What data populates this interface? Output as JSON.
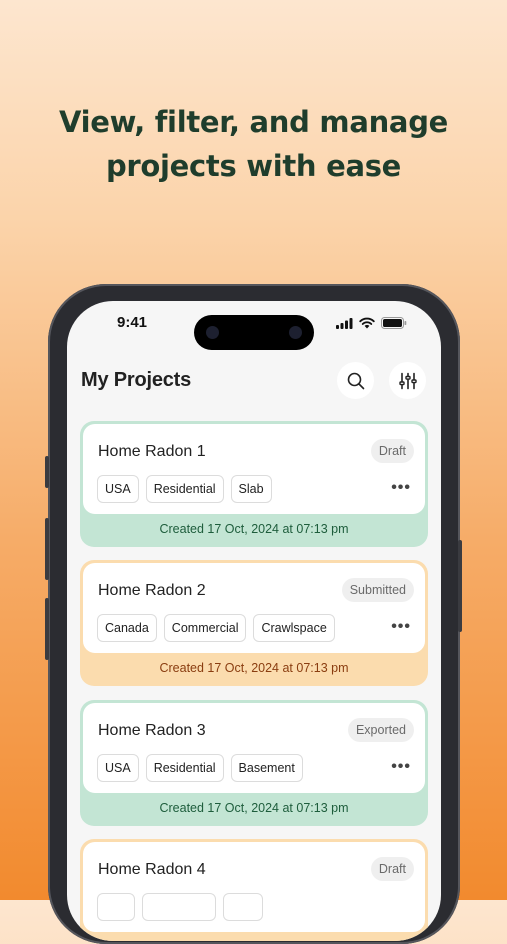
{
  "headline": {
    "line1": "View, filter, and manage",
    "line2": "projects with ease"
  },
  "status_bar": {
    "time": "9:41",
    "icons": [
      "signal-icon",
      "wifi-icon",
      "battery-icon"
    ]
  },
  "header": {
    "title": "My Projects",
    "search_icon": "search-icon",
    "filter_icon": "filter-icon"
  },
  "colors": {
    "headline": "#1f3d2c",
    "card_green": "#c3e5d4",
    "card_orange": "#fbdcae",
    "created_green": "#1e5d3c",
    "created_orange": "#8a3d10"
  },
  "projects": [
    {
      "name": "Home Radon 1",
      "status": "Draft",
      "tags": [
        "USA",
        "Residential",
        "Slab"
      ],
      "created": "Created 17 Oct, 2024 at 07:13 pm",
      "color": "green"
    },
    {
      "name": "Home Radon 2",
      "status": "Submitted",
      "tags": [
        "Canada",
        "Commercial",
        "Crawlspace"
      ],
      "created": "Created 17 Oct, 2024 at 07:13 pm",
      "color": "orange"
    },
    {
      "name": "Home Radon 3",
      "status": "Exported",
      "tags": [
        "USA",
        "Residential",
        "Basement"
      ],
      "created": "Created 17 Oct, 2024 at 07:13 pm",
      "color": "green"
    },
    {
      "name": "Home Radon 4",
      "status": "Draft",
      "tags": [],
      "created": "",
      "color": "orange"
    }
  ]
}
